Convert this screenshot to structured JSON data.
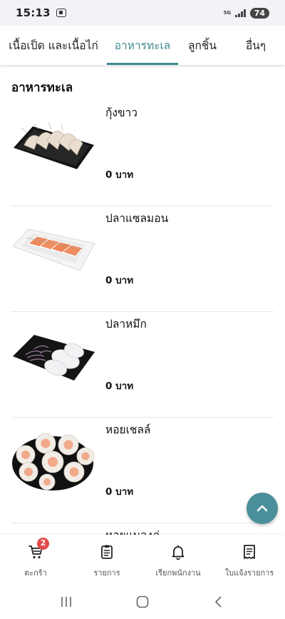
{
  "status_bar": {
    "time": "15:13",
    "network": "5G",
    "battery": "74"
  },
  "tabs": [
    {
      "label": "เนื้อเป็ด และเนื้อไก่",
      "active": false
    },
    {
      "label": "อาหารทะเล",
      "active": true
    },
    {
      "label": "ลูกชิ้น",
      "active": false
    },
    {
      "label": "อื่นๆ",
      "active": false
    }
  ],
  "section": {
    "title": "อาหารทะเล"
  },
  "items": [
    {
      "name": "กุ้งขาว",
      "price": "0 บาท"
    },
    {
      "name": "ปลาแซลมอน",
      "price": "0 บาท"
    },
    {
      "name": "ปลาหมึก",
      "price": "0 บาท"
    },
    {
      "name": "หอยเชลล์",
      "price": "0 บาท"
    },
    {
      "name": "หอยแมลงภู่",
      "price": ""
    }
  ],
  "bottom_nav": [
    {
      "label": "ตะกร้า",
      "icon": "cart-icon",
      "badge": "2"
    },
    {
      "label": "รายการ",
      "icon": "clipboard-icon"
    },
    {
      "label": "เรียกพนักงาน",
      "icon": "bell-icon"
    },
    {
      "label": "ใบแจ้งรายการ",
      "icon": "receipt-icon"
    }
  ],
  "colors": {
    "accent": "#3f8a92",
    "fab": "#4a8f99",
    "badge": "#e14b4b"
  }
}
